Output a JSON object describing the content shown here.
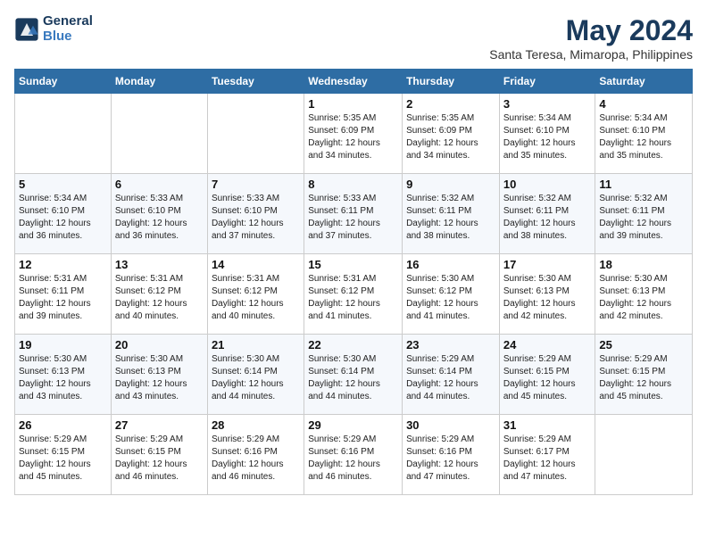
{
  "logo": {
    "line1": "General",
    "line2": "Blue"
  },
  "title": "May 2024",
  "location": "Santa Teresa, Mimaropa, Philippines",
  "weekdays": [
    "Sunday",
    "Monday",
    "Tuesday",
    "Wednesday",
    "Thursday",
    "Friday",
    "Saturday"
  ],
  "weeks": [
    [
      {
        "day": "",
        "info": ""
      },
      {
        "day": "",
        "info": ""
      },
      {
        "day": "",
        "info": ""
      },
      {
        "day": "1",
        "info": "Sunrise: 5:35 AM\nSunset: 6:09 PM\nDaylight: 12 hours\nand 34 minutes."
      },
      {
        "day": "2",
        "info": "Sunrise: 5:35 AM\nSunset: 6:09 PM\nDaylight: 12 hours\nand 34 minutes."
      },
      {
        "day": "3",
        "info": "Sunrise: 5:34 AM\nSunset: 6:10 PM\nDaylight: 12 hours\nand 35 minutes."
      },
      {
        "day": "4",
        "info": "Sunrise: 5:34 AM\nSunset: 6:10 PM\nDaylight: 12 hours\nand 35 minutes."
      }
    ],
    [
      {
        "day": "5",
        "info": "Sunrise: 5:34 AM\nSunset: 6:10 PM\nDaylight: 12 hours\nand 36 minutes."
      },
      {
        "day": "6",
        "info": "Sunrise: 5:33 AM\nSunset: 6:10 PM\nDaylight: 12 hours\nand 36 minutes."
      },
      {
        "day": "7",
        "info": "Sunrise: 5:33 AM\nSunset: 6:10 PM\nDaylight: 12 hours\nand 37 minutes."
      },
      {
        "day": "8",
        "info": "Sunrise: 5:33 AM\nSunset: 6:11 PM\nDaylight: 12 hours\nand 37 minutes."
      },
      {
        "day": "9",
        "info": "Sunrise: 5:32 AM\nSunset: 6:11 PM\nDaylight: 12 hours\nand 38 minutes."
      },
      {
        "day": "10",
        "info": "Sunrise: 5:32 AM\nSunset: 6:11 PM\nDaylight: 12 hours\nand 38 minutes."
      },
      {
        "day": "11",
        "info": "Sunrise: 5:32 AM\nSunset: 6:11 PM\nDaylight: 12 hours\nand 39 minutes."
      }
    ],
    [
      {
        "day": "12",
        "info": "Sunrise: 5:31 AM\nSunset: 6:11 PM\nDaylight: 12 hours\nand 39 minutes."
      },
      {
        "day": "13",
        "info": "Sunrise: 5:31 AM\nSunset: 6:12 PM\nDaylight: 12 hours\nand 40 minutes."
      },
      {
        "day": "14",
        "info": "Sunrise: 5:31 AM\nSunset: 6:12 PM\nDaylight: 12 hours\nand 40 minutes."
      },
      {
        "day": "15",
        "info": "Sunrise: 5:31 AM\nSunset: 6:12 PM\nDaylight: 12 hours\nand 41 minutes."
      },
      {
        "day": "16",
        "info": "Sunrise: 5:30 AM\nSunset: 6:12 PM\nDaylight: 12 hours\nand 41 minutes."
      },
      {
        "day": "17",
        "info": "Sunrise: 5:30 AM\nSunset: 6:13 PM\nDaylight: 12 hours\nand 42 minutes."
      },
      {
        "day": "18",
        "info": "Sunrise: 5:30 AM\nSunset: 6:13 PM\nDaylight: 12 hours\nand 42 minutes."
      }
    ],
    [
      {
        "day": "19",
        "info": "Sunrise: 5:30 AM\nSunset: 6:13 PM\nDaylight: 12 hours\nand 43 minutes."
      },
      {
        "day": "20",
        "info": "Sunrise: 5:30 AM\nSunset: 6:13 PM\nDaylight: 12 hours\nand 43 minutes."
      },
      {
        "day": "21",
        "info": "Sunrise: 5:30 AM\nSunset: 6:14 PM\nDaylight: 12 hours\nand 44 minutes."
      },
      {
        "day": "22",
        "info": "Sunrise: 5:30 AM\nSunset: 6:14 PM\nDaylight: 12 hours\nand 44 minutes."
      },
      {
        "day": "23",
        "info": "Sunrise: 5:29 AM\nSunset: 6:14 PM\nDaylight: 12 hours\nand 44 minutes."
      },
      {
        "day": "24",
        "info": "Sunrise: 5:29 AM\nSunset: 6:15 PM\nDaylight: 12 hours\nand 45 minutes."
      },
      {
        "day": "25",
        "info": "Sunrise: 5:29 AM\nSunset: 6:15 PM\nDaylight: 12 hours\nand 45 minutes."
      }
    ],
    [
      {
        "day": "26",
        "info": "Sunrise: 5:29 AM\nSunset: 6:15 PM\nDaylight: 12 hours\nand 45 minutes."
      },
      {
        "day": "27",
        "info": "Sunrise: 5:29 AM\nSunset: 6:15 PM\nDaylight: 12 hours\nand 46 minutes."
      },
      {
        "day": "28",
        "info": "Sunrise: 5:29 AM\nSunset: 6:16 PM\nDaylight: 12 hours\nand 46 minutes."
      },
      {
        "day": "29",
        "info": "Sunrise: 5:29 AM\nSunset: 6:16 PM\nDaylight: 12 hours\nand 46 minutes."
      },
      {
        "day": "30",
        "info": "Sunrise: 5:29 AM\nSunset: 6:16 PM\nDaylight: 12 hours\nand 47 minutes."
      },
      {
        "day": "31",
        "info": "Sunrise: 5:29 AM\nSunset: 6:17 PM\nDaylight: 12 hours\nand 47 minutes."
      },
      {
        "day": "",
        "info": ""
      }
    ]
  ]
}
